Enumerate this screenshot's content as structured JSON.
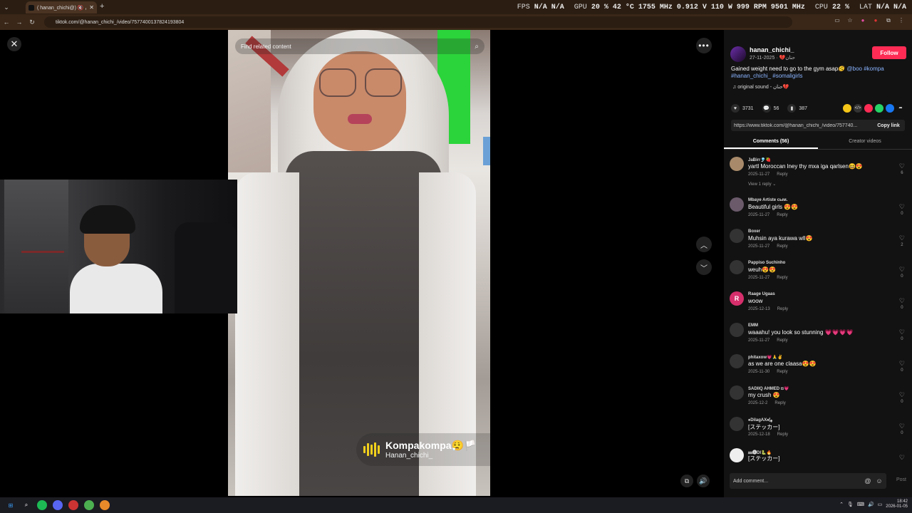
{
  "browser": {
    "tab_title": "( hanan_chichi@) 🔇 حنان",
    "url": "tiktok.com/@hanan_chichi_/video/7577400137824193804",
    "new_tab": "+"
  },
  "hud": {
    "fps_label": "FPS",
    "fps_value": "N/A",
    "fps_value2": "N/A",
    "gpu_label": "GPU",
    "gpu_pct": "20 %",
    "gpu_temp": "42 °C",
    "gpu_clock": "1755 MHz",
    "gpu_volt": "0.912 V",
    "gpu_power": "110 W",
    "gpu_rpm": "999 RPM",
    "gpu_mem": "9501 MHz",
    "cpu_label": "CPU",
    "cpu_pct": "22 %",
    "lat_label": "LAT",
    "lat_v1": "N/A",
    "lat_v2": "N/A"
  },
  "video": {
    "search_placeholder": "Find related content",
    "music_title": "Kompakompa😮‍💨🏳️",
    "music_author": "Hanan_chichi_"
  },
  "post": {
    "author": "hanan_chichi_",
    "sub": "حنان💔 · 2025-11-27",
    "follow": "Follow",
    "desc_text": "Gained weight need to go to the gym asap🫨",
    "desc_tags": "@boo #kompa #hanan_chichi_ #somaligirls",
    "sound": "♫ original sound - حنان💔",
    "likes": "3731",
    "comments": "56",
    "saves": "387",
    "link": "https://www.tiktok.com/@hanan_chichi_/video/757740...",
    "copy_link": "Copy link",
    "tab_comments": "Comments (56)",
    "tab_creator": "Creator videos"
  },
  "comments": [
    {
      "name": "JaBirr🎐🍓",
      "text": "yartl Moroccan lney thy mxa iga qarlsen😆😍",
      "date": "2025-11-27",
      "reply": "Reply",
      "likes": "6",
      "view": "View 1 reply ⌄"
    },
    {
      "name": "Mbaye Artiste сым.",
      "text": "Beautiful girls 😍😍",
      "date": "2025-11-27",
      "reply": "Reply",
      "likes": "0"
    },
    {
      "name": "Boxer",
      "text": "Muhsin aya kurawa wll😍",
      "date": "2025-11-27",
      "reply": "Reply",
      "likes": "2"
    },
    {
      "name": "Pappiso Suchinho",
      "text": "weuh😍😍",
      "date": "2025-11-27",
      "reply": "Reply",
      "likes": "0"
    },
    {
      "name": "Raage Ugaas",
      "text": "woow",
      "date": "2025-12-13",
      "reply": "Reply",
      "likes": "0",
      "initial": "R"
    },
    {
      "name": "EMM",
      "text": "waaahu! you look so stunning 💗💗💗💗",
      "date": "2025-11-27",
      "reply": "Reply",
      "likes": "0"
    },
    {
      "name": "phitaxow💗🙏✌",
      "text": "as we are one claasa😍😍",
      "date": "2025-11-30",
      "reply": "Reply",
      "likes": "0"
    },
    {
      "name": "SADIIQ AHMED ස💗",
      "text": "my crush 😍",
      "date": "2025-12-2",
      "reply": "Reply",
      "likes": "0"
    },
    {
      "name": "♠DilagAX♠🕯ﮭ",
      "text": "[ステッカー]",
      "date": "2025-12-18",
      "reply": "Reply",
      "likes": "0"
    },
    {
      "name": "⅏🅐Dl🐍🔥",
      "text": "[ステッカー]",
      "date": "",
      "reply": "",
      "likes": ""
    }
  ],
  "compose": {
    "placeholder": "Add comment...",
    "mention": "@",
    "emoji": "☺",
    "post": "Post"
  },
  "taskbar": {
    "time": "18:42",
    "date": "2026-01-05"
  },
  "colors": {
    "follow": "#fe2c55",
    "tag": "#8ab4ff",
    "music_bars": "#f2d01c"
  }
}
